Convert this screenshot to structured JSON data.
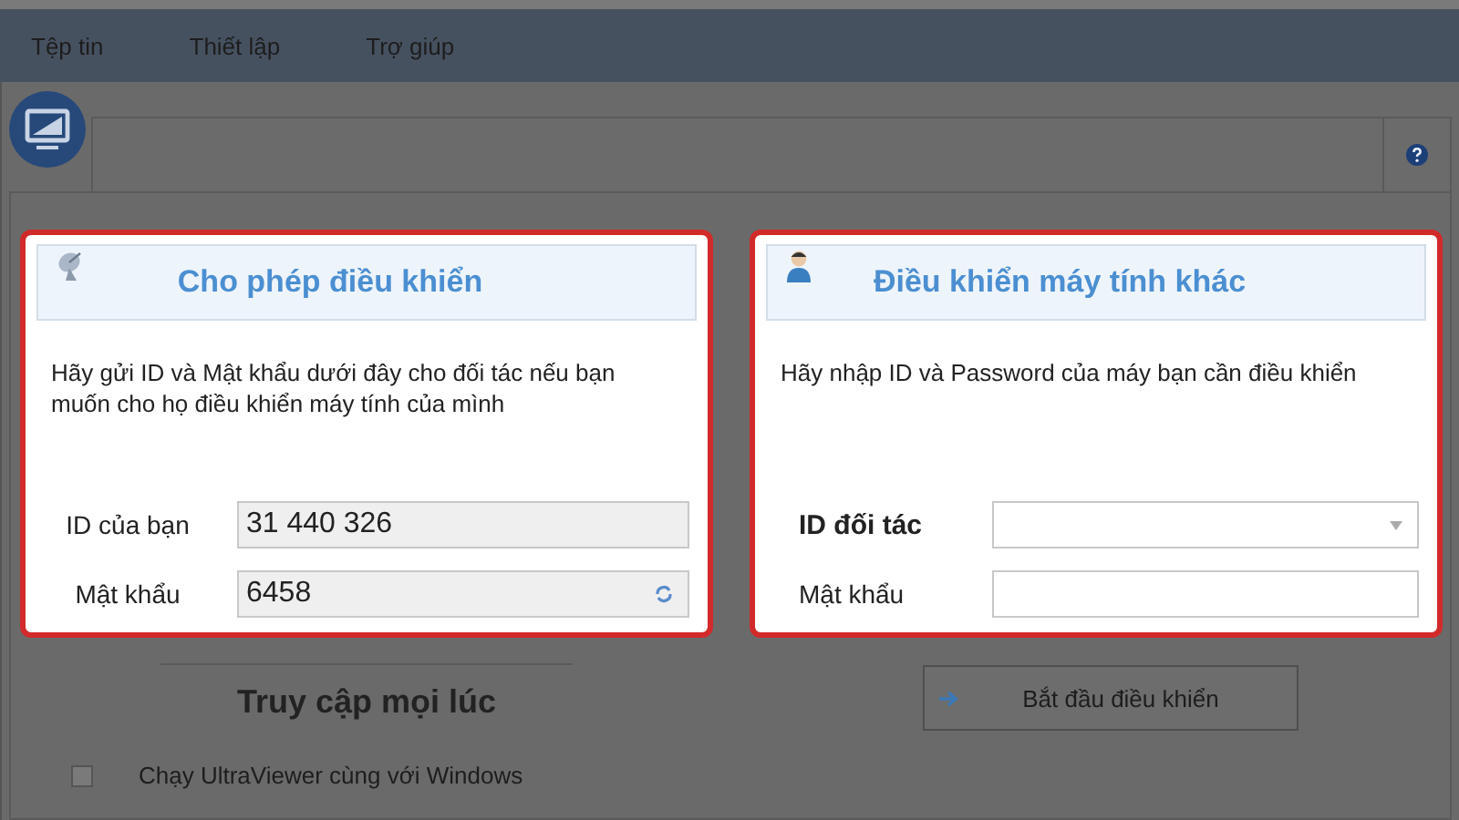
{
  "menu": [
    {
      "label": "Tệp tin"
    },
    {
      "label": "Thiết lập"
    },
    {
      "label": "Trợ giúp"
    }
  ],
  "panels": [
    {
      "kind": "allow",
      "title": "Cho phép điều khiển",
      "description": "Hãy gửi ID và Mật khẩu dưới đây cho đối tác nếu bạn muốn cho họ điều khiển máy tính của mình",
      "fields": [
        {
          "kind": "readonly",
          "label": "ID của bạn",
          "value": "31 440 326"
        },
        {
          "kind": "password",
          "label": "Mật khẩu",
          "value": "6458"
        }
      ]
    },
    {
      "kind": "control",
      "title": "Điều khiển máy tính khác",
      "description": "Hãy nhập ID và Password của máy bạn cần điều khiển",
      "fields": [
        {
          "kind": "combo",
          "label": "ID đối tác"
        },
        {
          "kind": "input",
          "label": "Mật khẩu"
        }
      ]
    }
  ],
  "access": {
    "title": "Truy cập mọi lúc",
    "options": [
      {
        "label": "Chạy UltraViewer cùng với Windows",
        "checked": false
      }
    ]
  },
  "start_button": {
    "label": "Bắt đầu điều khiển"
  }
}
